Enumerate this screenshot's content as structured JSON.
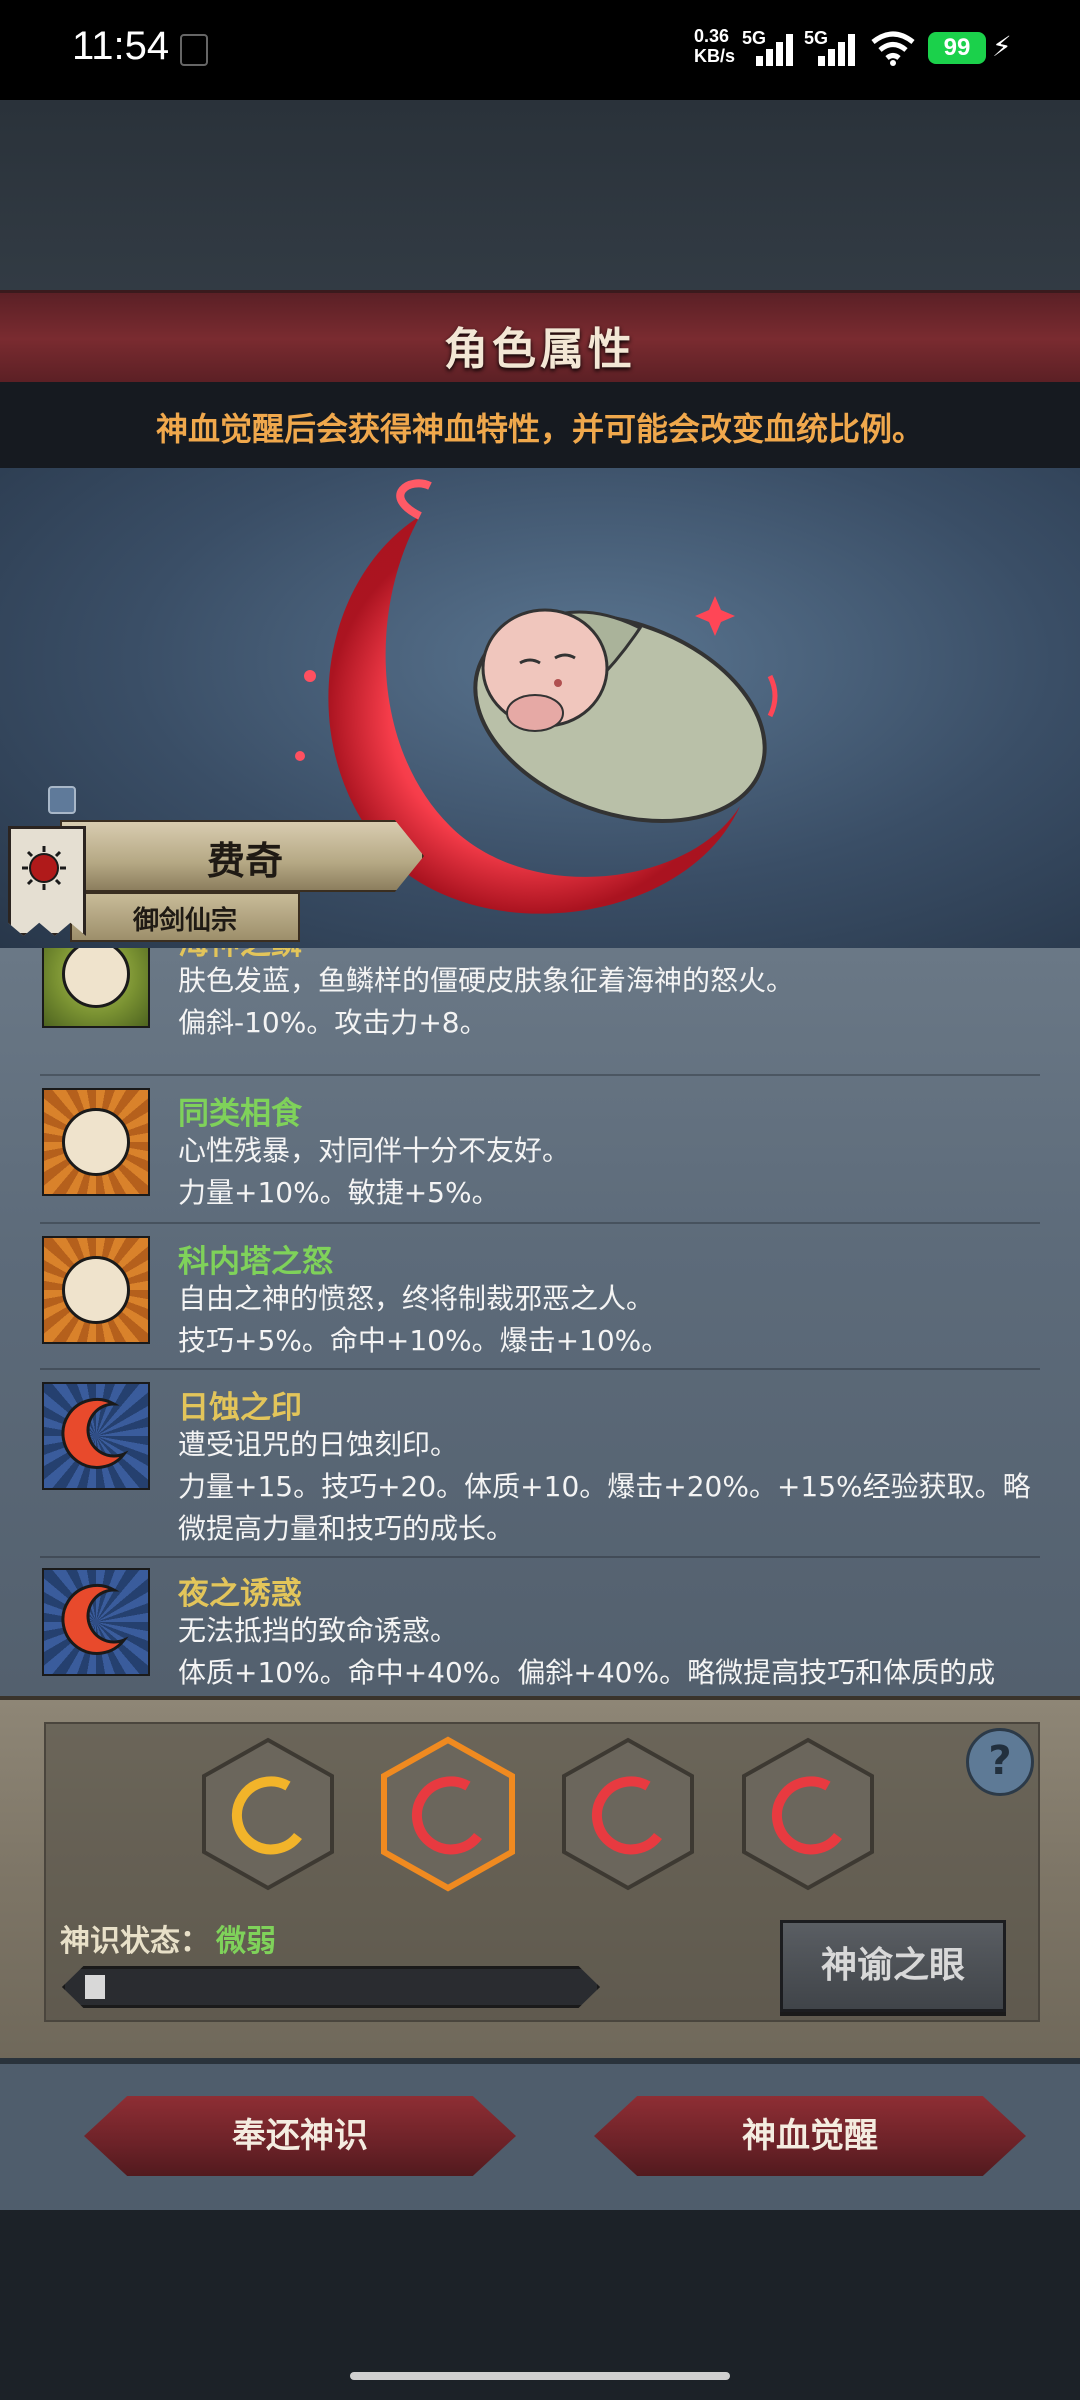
{
  "status_bar": {
    "time": "11:54",
    "net_speed_value": "0.36",
    "net_speed_unit": "KB/s",
    "signal1": "5G",
    "signal2": "5G",
    "battery": "99"
  },
  "header": {
    "title": "角色属性",
    "notice": "神血觉醒后会获得神血特性，并可能会改变血统比例。"
  },
  "character": {
    "name": "费奇",
    "sect": "御剑仙宗"
  },
  "traits": [
    {
      "name": "海神之鳞",
      "desc": "肤色发蓝，鱼鳞样的僵硬皮肤象征着海神的怒火。",
      "effect": "偏斜-10%。攻击力+8。",
      "icon": "sad-face-icon"
    },
    {
      "name": "同类相食",
      "desc": "心性残暴，对同伴十分不友好。",
      "effect": "力量+10%。敏捷+5%。",
      "icon": "happy-face-icon"
    },
    {
      "name": "科内塔之怒",
      "desc": "自由之神的愤怒，终将制裁邪恶之人。",
      "effect": "技巧+5%。命中+10%。爆击+10%。",
      "icon": "happy-face-icon"
    },
    {
      "name": "日蚀之印",
      "desc": "遭受诅咒的日蚀刻印。",
      "effect": "力量+15。技巧+20。体质+10。爆击+20%。+15%经验获取。略微提高力量和技巧的成长。",
      "icon": "crescent-moon-icon"
    },
    {
      "name": "夜之诱惑",
      "desc": "无法抵挡的致命诱惑。",
      "effect": "体质+10%。命中+40%。偏斜+40%。略微提高技巧和体质的成长。",
      "icon": "crescent-moon-icon"
    }
  ],
  "panel": {
    "status_label": "神识状态：",
    "status_value": "微弱",
    "progress": 0.04,
    "oracle_button": "神谕之眼",
    "help": "?"
  },
  "footer": {
    "return_button": "奉还神识",
    "awaken_button": "神血觉醒"
  },
  "colors": {
    "accent_orange": "#f0a84c",
    "trait_green": "#7fd25a",
    "trait_yellow": "#e3c55a",
    "header_red": "#7a2b30"
  }
}
